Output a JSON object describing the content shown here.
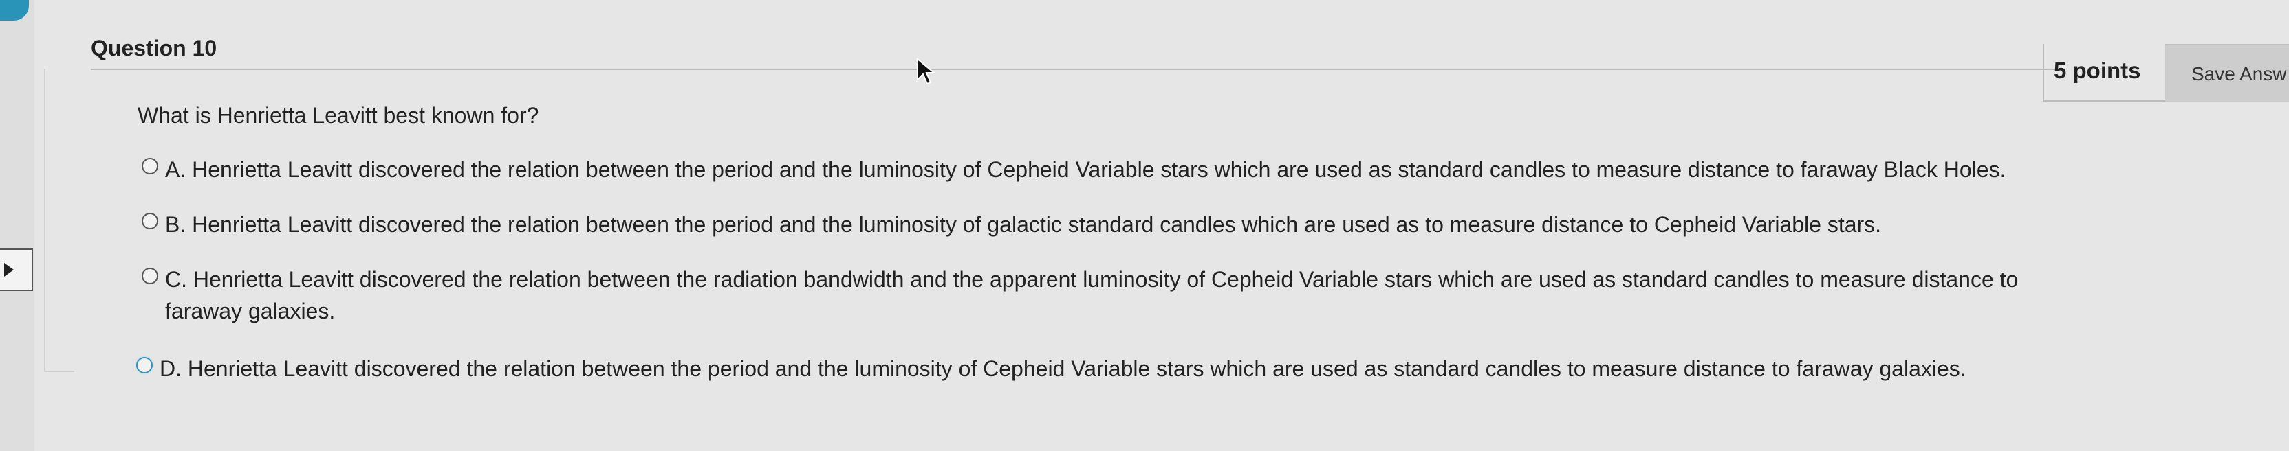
{
  "question": {
    "title": "Question 10",
    "points": "5 points",
    "save_label": "Save Answ",
    "text": "What is Henrietta Leavitt best known for?"
  },
  "options": [
    {
      "label": "A. Henrietta Leavitt discovered the relation between the period and the luminosity of Cepheid Variable stars which are used as standard candles to measure distance to faraway Black Holes."
    },
    {
      "label": "B. Henrietta Leavitt discovered the relation between the period and the luminosity of galactic standard candles which are used as to measure distance to Cepheid Variable stars."
    },
    {
      "label_line1": "C. Henrietta Leavitt discovered the relation between the radiation bandwidth and the apparent luminosity of Cepheid Variable stars which are used as standard candles to measure distance to",
      "label_line2": "faraway galaxies."
    },
    {
      "label": "D. Henrietta Leavitt discovered the relation between the period and the luminosity of Cepheid Variable stars which are used as standard candles to measure distance to faraway galaxies."
    }
  ],
  "colors": {
    "background": "#e6e6e6",
    "accent_blue": "#2a93b8",
    "text": "#222222"
  },
  "icons": {
    "sidebar_toggle": "triangle-right-icon",
    "cursor": "mouse-pointer-icon"
  }
}
